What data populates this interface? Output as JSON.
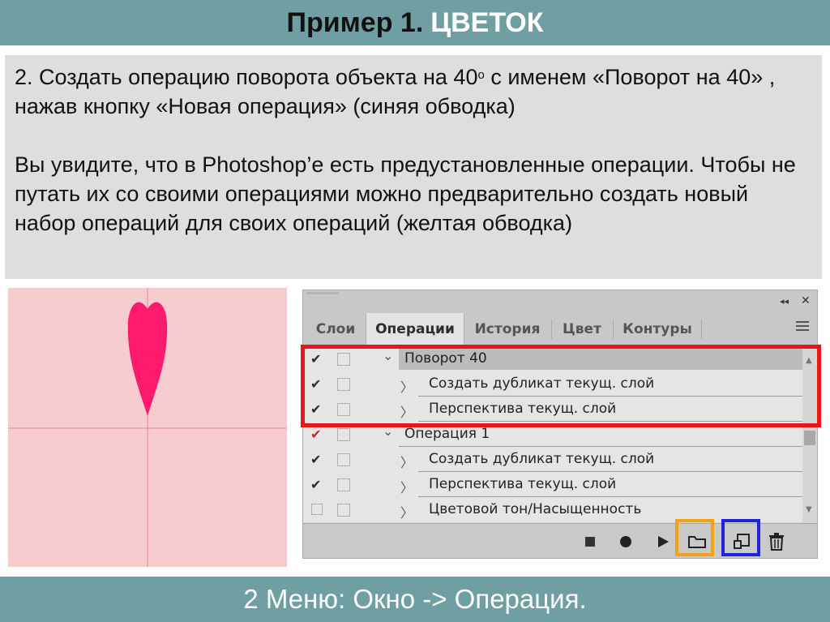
{
  "title": {
    "prefix": "Пример 1.",
    "highlight": "ЦВЕТОК"
  },
  "instructions": {
    "p1_a": "2. Создать  операцию поворота объекта на 40",
    "p1_sup": "о",
    "p1_b": " с именем «Поворот на 40» , нажав кнопку «Новая операция» (синяя обводка)",
    "p2": "Вы увидите, что в Photoshop’е есть предустановленные операции. Чтобы не путать их со своими операциями можно предварительно создать новый набор операций для своих операций (желтая обводка)"
  },
  "canvas": {
    "background": "#f6cccf",
    "petal_color": "#ff1a6e",
    "guide_color": "#e88890"
  },
  "panel": {
    "tabs": [
      {
        "label": "Слои",
        "active": false
      },
      {
        "label": "Операции",
        "active": true
      },
      {
        "label": "История",
        "active": false
      },
      {
        "label": "Цвет",
        "active": false
      },
      {
        "label": "Контуры",
        "active": false
      }
    ],
    "rows": [
      {
        "label": "Поворот 40",
        "level": 0,
        "checked": true,
        "selected": true,
        "red_check": false
      },
      {
        "label": "Создать дубликат текущ. слой",
        "level": 1,
        "checked": true,
        "selected": false,
        "red_check": false
      },
      {
        "label": "Перспектива текущ. слой",
        "level": 1,
        "checked": true,
        "selected": false,
        "red_check": false
      },
      {
        "label": "Операция 1",
        "level": 0,
        "checked": true,
        "selected": false,
        "red_check": true
      },
      {
        "label": "Создать дубликат текущ. слой",
        "level": 1,
        "checked": true,
        "selected": false,
        "red_check": false
      },
      {
        "label": "Перспектива текущ. слой",
        "level": 1,
        "checked": true,
        "selected": false,
        "red_check": false
      },
      {
        "label": "Цветовой тон/Насыщенность",
        "level": 1,
        "checked": false,
        "selected": false,
        "red_check": false
      }
    ],
    "icons": {
      "check": "✔",
      "collapse": "◂◂",
      "close": "✕",
      "arrow_down": "⌄",
      "arrow_right": "〉",
      "scroll_up": "▲",
      "scroll_down": "▼"
    }
  },
  "highlights": {
    "red": "#e8151a",
    "orange": "#f5a212",
    "blue": "#2222dd"
  },
  "footer": {
    "text": "2 Меню: Окно -> Операция."
  }
}
